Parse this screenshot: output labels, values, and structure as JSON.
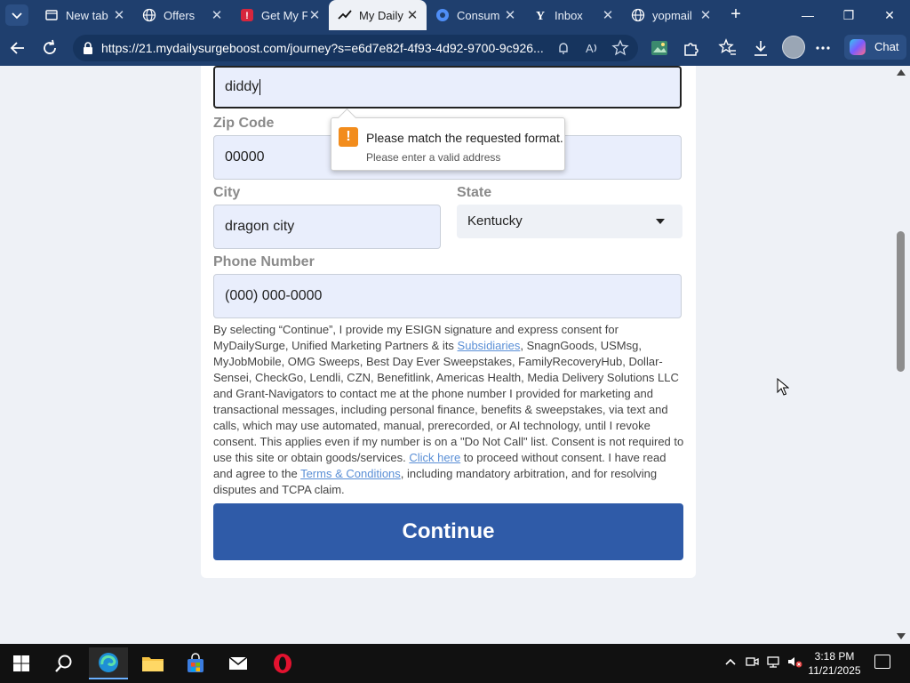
{
  "browser": {
    "tabs": [
      {
        "label": "New tab",
        "icon": "new-tab-icon",
        "active": false
      },
      {
        "label": "Offers",
        "icon": "globe-icon",
        "active": false
      },
      {
        "label": "Get My F",
        "icon": "alert-site-icon",
        "active": false
      },
      {
        "label": "My Daily",
        "icon": "trend-icon",
        "active": true
      },
      {
        "label": "Consum",
        "icon": "copilot-site-icon",
        "active": false
      },
      {
        "label": "Inbox",
        "icon": "yahoo-icon",
        "active": false
      },
      {
        "label": "yopmail",
        "icon": "globe-icon",
        "active": false
      }
    ],
    "url": "https://21.mydailysurgeboost.com/journey?s=e6d7e82f-4f93-4d92-9700-9c926...",
    "chat_label": "Chat"
  },
  "form": {
    "address_value": "diddy",
    "zip_label": "Zip Code",
    "zip_value": "00000",
    "city_label": "City",
    "city_value": "dragon city",
    "state_label": "State",
    "state_value": "Kentucky",
    "phone_label": "Phone Number",
    "phone_value": "(000) 000-0000",
    "tooltip_title": "Please match the requested format.",
    "tooltip_detail": "Please enter a valid address",
    "continue_label": "Continue"
  },
  "consent": {
    "part1": "By selecting “Continue”, I provide my ESIGN signature and express consent for MyDailySurge, Unified Marketing Partners & its ",
    "subsidiaries_link": "Subsidiaries",
    "part2": ", SnagnGoods, USMsg, MyJobMobile, OMG Sweeps, Best Day Ever Sweepstakes, FamilyRecoveryHub, Dollar-Sensei, CheckGo, Lendli, CZN, Benefitlink, Americas Health, Media Delivery Solutions LLC and Grant-Navigators to contact me at the phone number I provided for marketing and transactional messages, including personal finance, benefits & sweepstakes, via text and calls, which may use automated, manual, prerecorded, or AI technology, until I revoke consent. This applies even if my number is on a \"Do Not Call\" list. Consent is not required to use this site or obtain goods/services. ",
    "click_here_link": "Click here",
    "part3": " to proceed without consent. I have read and agree to the ",
    "terms_link": "Terms & Conditions",
    "part4": ", including mandatory arbitration, and for resolving disputes and TCPA claim."
  },
  "taskbar": {
    "time": "3:18 PM",
    "date": "11/21/2025"
  },
  "colors": {
    "browser_chrome": "#1f3f6e",
    "continue_button": "#2f5ba8",
    "link": "#5a8fd6",
    "warning": "#f28c1c"
  }
}
